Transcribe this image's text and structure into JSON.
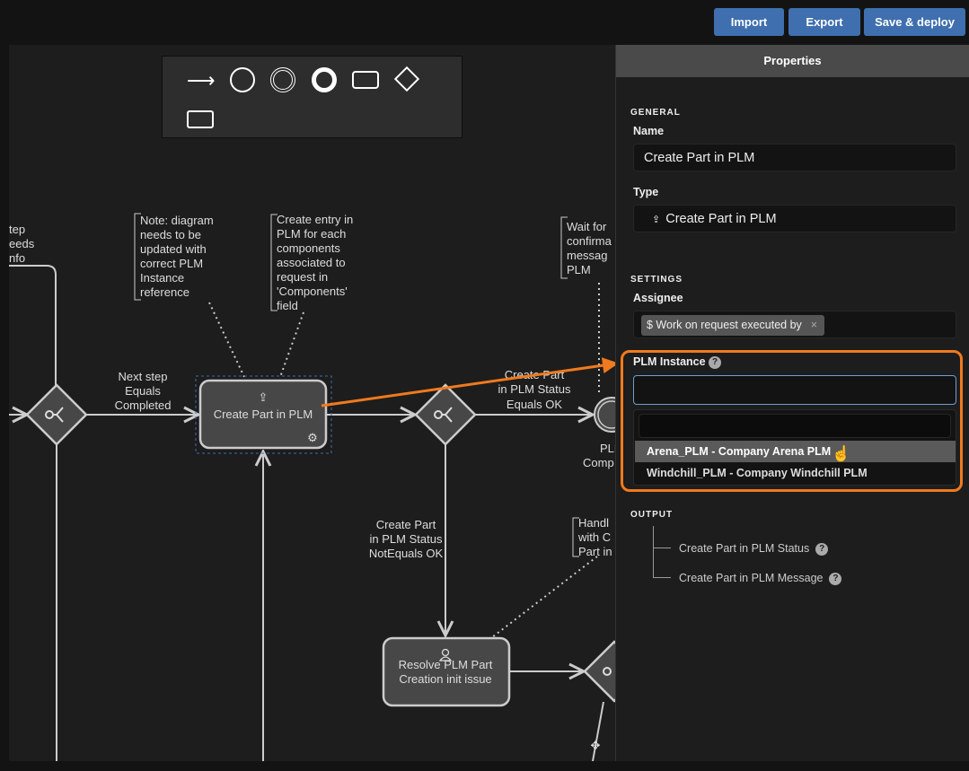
{
  "toolbar": {
    "import": "Import",
    "export": "Export",
    "save_deploy": "Save & deploy"
  },
  "palette": {
    "items": [
      "sequence-flow-icon",
      "start-event-icon",
      "intermediate-event-icon",
      "end-event-icon",
      "task-icon",
      "gateway-icon",
      "annotation-icon"
    ]
  },
  "diagram": {
    "left_fragment": [
      "tep",
      "eeds",
      "nfo"
    ],
    "flow_next_step": [
      "Next step",
      "Equals",
      "Completed"
    ],
    "note_diagram": [
      "Note: diagram",
      "needs to be",
      "updated with",
      "correct PLM",
      "Instance",
      "reference"
    ],
    "note_create_entry": [
      "Create entry in",
      "PLM for each",
      "components",
      "associated to",
      "request in",
      "'Components'",
      "field"
    ],
    "note_wait": [
      "Wait for",
      "confirma",
      "messag",
      "PLM"
    ],
    "task_create_part": "Create Part in PLM",
    "flow_equals_ok": [
      "Create Part",
      "in PLM Status",
      "Equals OK"
    ],
    "event_label": [
      "PLM",
      "Comp"
    ],
    "flow_not_equals": [
      "Create Part",
      "in PLM Status",
      "NotEquals OK"
    ],
    "note_handle": [
      "Handl",
      "with C",
      "Part in"
    ],
    "task_resolve": [
      "Resolve PLM Part",
      "Creation init issue"
    ],
    "highlight_color": "#f07a1e",
    "accent_color": "#3f6fae"
  },
  "properties": {
    "title": "Properties",
    "general_heading": "GENERAL",
    "name_label": "Name",
    "name_value": "Create Part in PLM",
    "type_label": "Type",
    "type_value": "Create Part in PLM",
    "settings_heading": "SETTINGS",
    "assignee_label": "Assignee",
    "assignee_chip": "$ Work on request executed by",
    "plm_label": "PLM Instance",
    "plm_value": "",
    "plm_search": "",
    "plm_options": [
      "Arena_PLM - Company Arena PLM",
      "Windchill_PLM - Company Windchill PLM"
    ],
    "output_heading": "OUTPUT",
    "outputs": [
      "Create Part in PLM Status",
      "Create Part in PLM Message"
    ]
  }
}
